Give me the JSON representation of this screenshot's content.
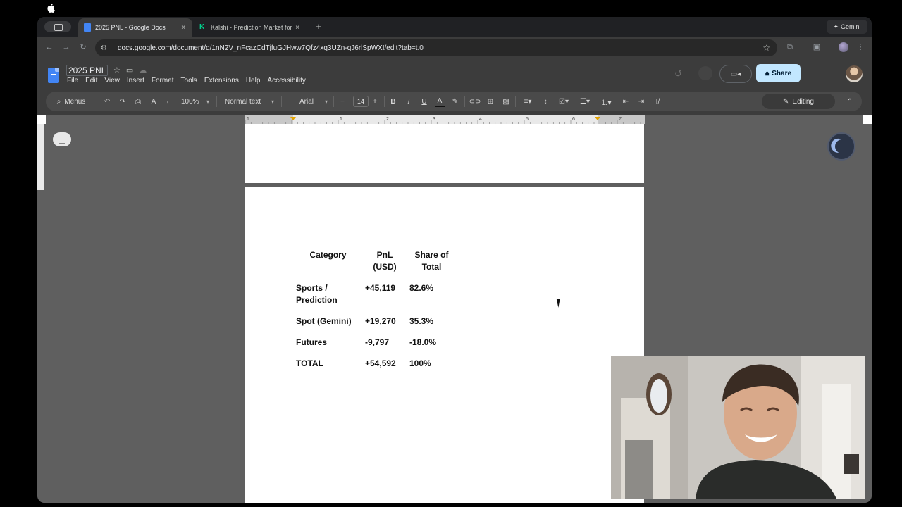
{
  "browser": {
    "tabs": [
      {
        "title": "2025 PNL - Google Docs",
        "favicon_color": "#4285f4",
        "close": "×"
      },
      {
        "title": "Kalshi - Prediction Market for",
        "favicon_color": "#00d18c",
        "favicon_letter": "K",
        "close": "×"
      }
    ],
    "new_tab": "+",
    "gemini_label": "Gemini",
    "url": "docs.google.com/document/d/1nN2V_nFcazCdTjfuGJHww7Qfz4xq3UZn-qJ6rlSpWXI/edit?tab=t.0"
  },
  "docs": {
    "title": "2025 PNL",
    "menu": [
      "File",
      "Edit",
      "View",
      "Insert",
      "Format",
      "Tools",
      "Extensions",
      "Help",
      "Accessibility"
    ],
    "share_label": "Share"
  },
  "toolbar": {
    "menus_label": "Menus",
    "zoom": "100%",
    "style": "Normal text",
    "font": "Arial",
    "font_size": "14",
    "mode": "Editing"
  },
  "ruler": {
    "labels": [
      "1",
      "1",
      "2",
      "3",
      "4",
      "5",
      "6",
      "7"
    ]
  },
  "table": {
    "headers": [
      "Category",
      "PnL (USD)",
      "Share of Total"
    ],
    "rows": [
      [
        "Sports / Prediction",
        "+45,119",
        "82.6%"
      ],
      [
        "Spot (Gemini)",
        "+19,270",
        "35.3%"
      ],
      [
        "Futures",
        "-9,797",
        "-18.0%"
      ],
      [
        "TOTAL",
        "+54,592",
        "100%"
      ]
    ]
  },
  "colors": {
    "accent_share": "#c2e7ff",
    "docs_blue": "#4285f4",
    "kalshi_green": "#00d18c"
  }
}
